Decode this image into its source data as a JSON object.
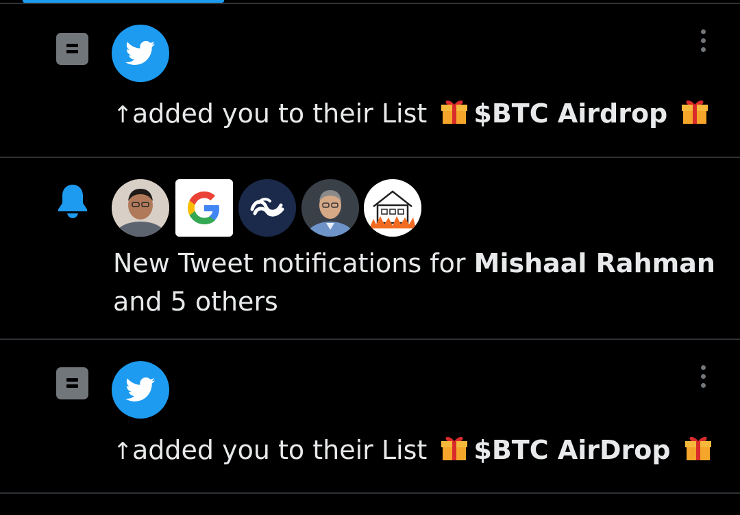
{
  "notifications": [
    {
      "type": "list_add",
      "text": "added you to their List",
      "list_name": "$BTC Airdrop",
      "icons": [
        "list-icon",
        "twitter-bird-icon",
        "more-vertical-icon",
        "gift-emoji"
      ]
    },
    {
      "type": "new_tweets",
      "text_prefix": "New Tweet notifications for",
      "user_name": "Mishaal Rahman",
      "text_suffix": "and 5 others",
      "icons": [
        "bell-icon"
      ],
      "avatars": [
        "person-avatar",
        "google-logo-avatar",
        "nebula-logo-avatar",
        "person-avatar",
        "house-fire-avatar"
      ]
    },
    {
      "type": "list_add",
      "text": "added you to their List",
      "list_name": "$BTC AirDrop",
      "icons": [
        "list-icon",
        "twitter-bird-icon",
        "more-vertical-icon",
        "gift-emoji"
      ]
    }
  ],
  "colors": {
    "background": "#000000",
    "text": "#e7e9ea",
    "muted": "#71767b",
    "accent": "#1d9bf0",
    "divider": "#2f3336"
  }
}
